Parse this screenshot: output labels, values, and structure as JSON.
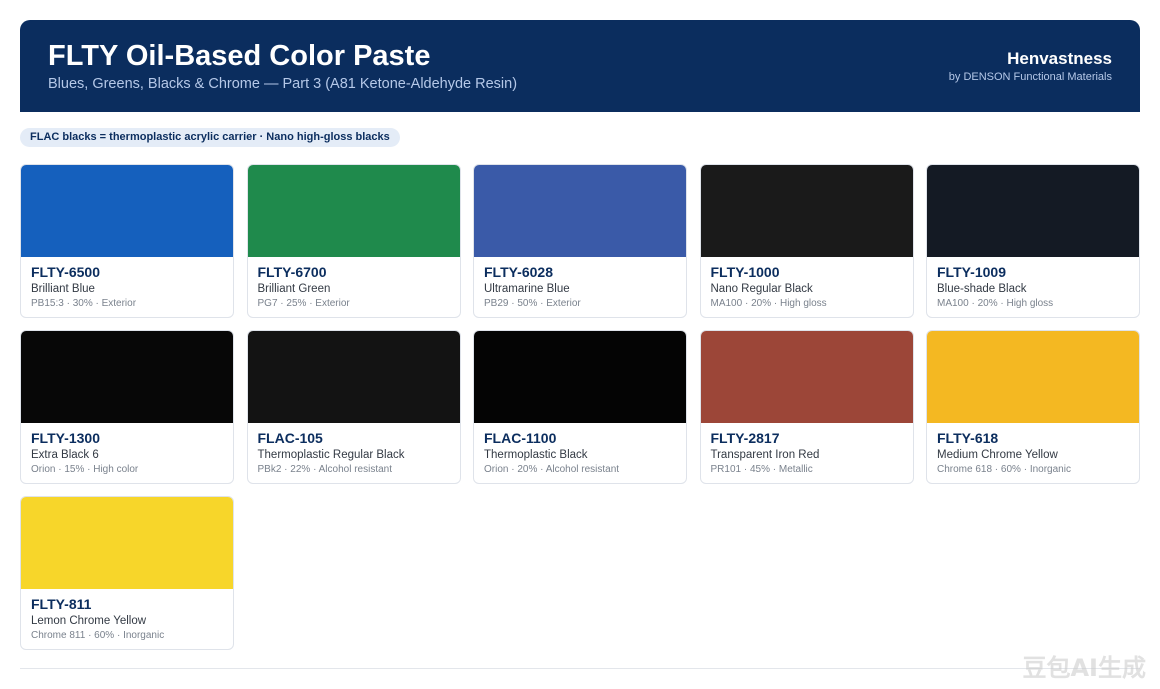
{
  "header": {
    "title": "FLTY Oil-Based Color Paste",
    "subtitle": "Blues, Greens, Blacks & Chrome — Part 3 (A81 Ketone-Aldehyde Resin)",
    "brand": "Henvastness",
    "brand_sub": "by DENSON Functional Materials"
  },
  "note": "FLAC blacks = thermoplastic acrylic carrier · Nano high-gloss blacks",
  "products": [
    {
      "code": "FLTY-6500",
      "name": "Brilliant Blue",
      "spec": "PB15:3 · 30% · Exterior",
      "color": "#1560bd"
    },
    {
      "code": "FLTY-6700",
      "name": "Brilliant Green",
      "spec": "PG7 · 25% · Exterior",
      "color": "#1f8a4c"
    },
    {
      "code": "FLTY-6028",
      "name": "Ultramarine Blue",
      "spec": "PB29 · 50% · Exterior",
      "color": "#3a5aa8"
    },
    {
      "code": "FLTY-1000",
      "name": "Nano Regular Black",
      "spec": "MA100 · 20% · High gloss",
      "color": "#1a1a1a"
    },
    {
      "code": "FLTY-1009",
      "name": "Blue-shade Black",
      "spec": "MA100 · 20% · High gloss",
      "color": "#141a24"
    },
    {
      "code": "FLTY-1300",
      "name": "Extra Black 6",
      "spec": "Orion · 15% · High color",
      "color": "#070707"
    },
    {
      "code": "FLAC-105",
      "name": "Thermoplastic Regular Black",
      "spec": "PBk2 · 22% · Alcohol resistant",
      "color": "#131313"
    },
    {
      "code": "FLAC-1100",
      "name": "Thermoplastic Black",
      "spec": "Orion · 20% · Alcohol resistant",
      "color": "#040404"
    },
    {
      "code": "FLTY-2817",
      "name": "Transparent Iron Red",
      "spec": "PR101 · 45% · Metallic",
      "color": "#9c4638"
    },
    {
      "code": "FLTY-618",
      "name": "Medium Chrome Yellow",
      "spec": "Chrome 618 · 60% · Inorganic",
      "color": "#f4b822"
    },
    {
      "code": "FLTY-811",
      "name": "Lemon Chrome Yellow",
      "spec": "Chrome 811 · 60% · Inorganic",
      "color": "#f7d62a"
    }
  ],
  "watermark": "豆包AI生成"
}
